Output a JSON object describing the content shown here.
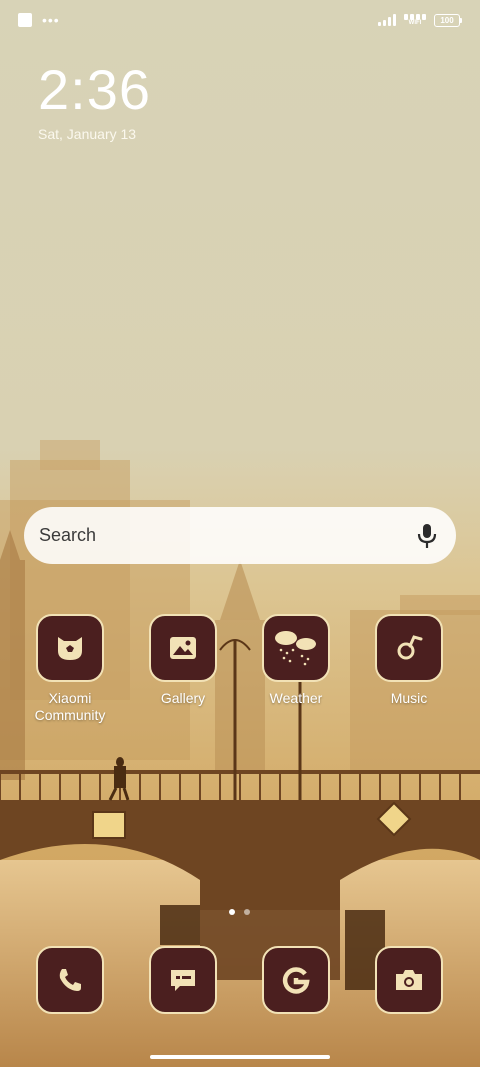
{
  "status_bar": {
    "wifi_label": "WIFI",
    "battery": "100"
  },
  "clock": {
    "time": "2:36",
    "date": "Sat, January 13"
  },
  "search": {
    "placeholder": "Search"
  },
  "apps": [
    {
      "label": "Xiaomi Community",
      "icon": "xiaomi-community-icon"
    },
    {
      "label": "Gallery",
      "icon": "gallery-icon"
    },
    {
      "label": "Weather",
      "icon": "weather-icon"
    },
    {
      "label": "Music",
      "icon": "music-icon"
    }
  ],
  "dock": [
    {
      "icon": "phone-icon"
    },
    {
      "icon": "messages-icon"
    },
    {
      "icon": "google-icon"
    },
    {
      "icon": "camera-icon"
    }
  ],
  "page_indicator": {
    "pages": 2,
    "current": 1
  },
  "colors": {
    "icon_tile": "#4b1f1f",
    "icon_border": "#f2e2b6",
    "sky": "#d8d2b6",
    "sepia": "#c8a35f"
  }
}
